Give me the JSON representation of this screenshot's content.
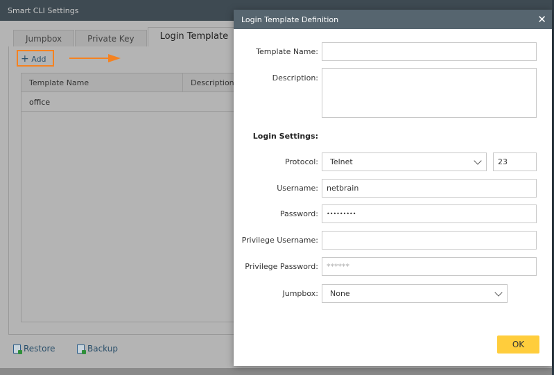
{
  "background_dialog": {
    "title": "Smart CLI Settings",
    "tabs": [
      {
        "label": "Jumpbox"
      },
      {
        "label": "Private Key"
      },
      {
        "label": "Login Template",
        "active": true
      }
    ],
    "add_label": "Add",
    "table": {
      "columns": [
        "Template Name",
        "Description"
      ],
      "rows": [
        {
          "name": "office",
          "description": ""
        }
      ]
    },
    "restore_label": "Restore",
    "backup_label": "Backup"
  },
  "dialog": {
    "title": "Login Template Definition",
    "fields": {
      "template_name": {
        "label": "Template Name:",
        "value": ""
      },
      "description": {
        "label": "Description:",
        "value": ""
      },
      "section": "Login Settings:",
      "protocol": {
        "label": "Protocol:",
        "value": "Telnet",
        "port": "23"
      },
      "username": {
        "label": "Username:",
        "value": "netbrain"
      },
      "password": {
        "label": "Password:",
        "value": "•••••••••"
      },
      "privilege_username": {
        "label": "Privilege Username:",
        "value": ""
      },
      "privilege_password": {
        "label": "Privilege Password:",
        "placeholder": "******"
      },
      "jumpbox": {
        "label": "Jumpbox:",
        "value": "None"
      }
    },
    "ok_label": "OK"
  },
  "colors": {
    "highlight": "#f58220",
    "ok_button": "#ffcd3c",
    "dialog_header": "#56656f"
  }
}
